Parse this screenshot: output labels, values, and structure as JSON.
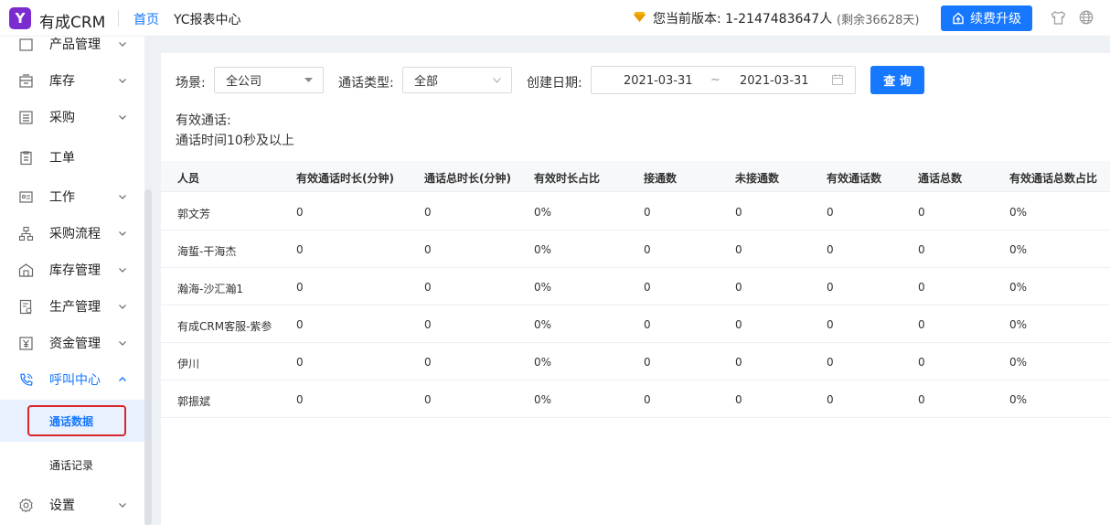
{
  "app": {
    "logo_letter": "Y",
    "name": "有成CRM"
  },
  "nav": {
    "home": "首页",
    "report": "YC报表中心"
  },
  "header": {
    "version_text": "您当前版本: 1-2147483647人",
    "remaining_text": "(剩余36628天)",
    "upgrade_label": "续费升级"
  },
  "sidebar": {
    "partial_top": "产品管理",
    "items": [
      {
        "label": "库存",
        "icon": "inventory-icon"
      },
      {
        "label": "采购",
        "icon": "purchase-icon"
      },
      {
        "label": "工单",
        "icon": "ticket-icon"
      },
      {
        "label": "工作",
        "icon": "work-icon"
      },
      {
        "label": "采购流程",
        "icon": "flow-icon"
      },
      {
        "label": "库存管理",
        "icon": "warehouse-icon"
      },
      {
        "label": "生产管理",
        "icon": "production-icon"
      },
      {
        "label": "资金管理",
        "icon": "yen-icon"
      },
      {
        "label": "呼叫中心",
        "icon": "phone-icon"
      },
      {
        "label": "设置",
        "icon": "gear-icon"
      }
    ],
    "sub_items": [
      {
        "label": "通话数据"
      },
      {
        "label": "通话记录"
      }
    ]
  },
  "filters": {
    "scene_label": "场景:",
    "scene_value": "全公司",
    "call_type_label": "通话类型:",
    "call_type_value": "全部",
    "date_label": "创建日期:",
    "date_start": "2021-03-31",
    "date_sep": "~",
    "date_end": "2021-03-31",
    "query_label": "查 询"
  },
  "notes": {
    "line1": "有效通话:",
    "line2": "通话时间10秒及以上"
  },
  "table": {
    "headers": [
      "人员",
      "有效通话时长(分钟)",
      "通话总时长(分钟)",
      "有效时长占比",
      "接通数",
      "未接通数",
      "有效通话数",
      "通话总数",
      "有效通话总数占比"
    ],
    "rows": [
      [
        "郭文芳",
        "0",
        "0",
        "0%",
        "0",
        "0",
        "0",
        "0",
        "0%"
      ],
      [
        "海蜇-干海杰",
        "0",
        "0",
        "0%",
        "0",
        "0",
        "0",
        "0",
        "0%"
      ],
      [
        "瀚海-沙汇瀚1",
        "0",
        "0",
        "0%",
        "0",
        "0",
        "0",
        "0",
        "0%"
      ],
      [
        "有成CRM客服-紫参",
        "0",
        "0",
        "0%",
        "0",
        "0",
        "0",
        "0",
        "0%"
      ],
      [
        "伊川",
        "0",
        "0",
        "0%",
        "0",
        "0",
        "0",
        "0",
        "0%"
      ],
      [
        "郭振斌",
        "0",
        "0",
        "0%",
        "0",
        "0",
        "0",
        "0",
        "0%"
      ]
    ]
  },
  "colors": {
    "accent": "#1677ff",
    "brand": "#7b2cd1",
    "highlight": "#d9262c"
  }
}
